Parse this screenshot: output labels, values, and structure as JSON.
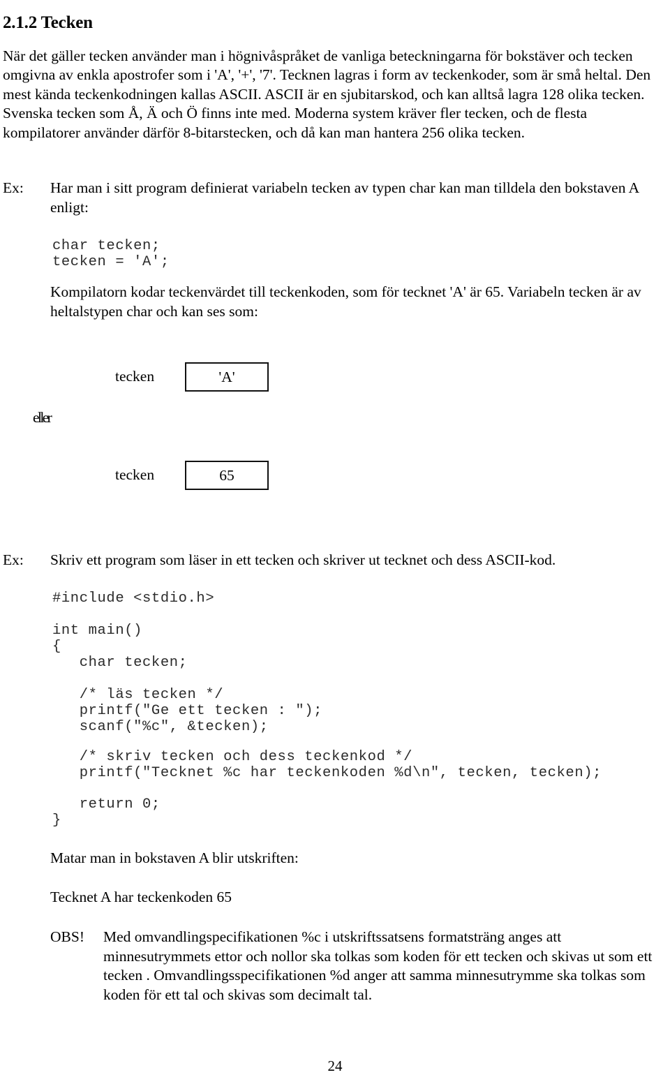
{
  "document": {
    "heading": "2.1.2 Tecken",
    "page_number": "24",
    "intro_paragraph": "När det gäller tecken använder man i högnivåspråket de vanliga beteckningarna för bokstäver och tecken omgivna av enkla apostrofer som i 'A', '+', '7'. Tecknen lagras i form av teckenkoder, som är små heltal. Den mest kända teckenkodningen kallas ASCII. ASCII är en sjubitarskod, och kan alltså lagra 128 olika tecken. Svenska tecken som Å, Ä och Ö finns inte med. Moderna system kräver fler tecken, och de flesta kompilatorer använder därför 8-bitarstecken, och då kan man hantera 256 olika tecken."
  },
  "example_one": {
    "label": "Ex:",
    "intro": "Har man i sitt program definierat variabeln tecken av typen char kan man tilldela den bokstaven A enligt:",
    "code": "char tecken;\ntecken = 'A';",
    "explanation": "Kompilatorn kodar teckenvärdet till teckenkoden, som för tecknet 'A' är 65. Variabeln tecken är av heltalstypen char och kan ses som:"
  },
  "diagram": {
    "box_one_label": "tecken",
    "box_one_value": "'A'",
    "connector_text": "eller",
    "box_two_label": "tecken",
    "box_two_value": "65"
  },
  "example_two": {
    "label": "Ex:",
    "intro": "Skriv ett program som läser in ett tecken och skriver ut tecknet och dess ASCII-kod.",
    "code_include": "#include <stdio.h>",
    "code_main": "int main()\n{\n   char tecken;",
    "code_read": "   /* läs tecken */\n   printf(\"Ge ett tecken : \");\n   scanf(\"%c\", &tecken);",
    "code_write": "   /* skriv tecken och dess teckenkod */\n   printf(\"Tecknet %c har teckenkoden %d\\n\", tecken, tecken);",
    "code_return": "   return 0;\n}",
    "output_intro": "Matar man in bokstaven A blir utskriften:",
    "output_text": "Tecknet A har teckenkoden 65"
  },
  "note": {
    "label": "OBS!",
    "text": "Med omvandlingspecifikationen %c i utskriftssatsens formatsträng anges att minnesutrymmets ettor och nollor ska tolkas som koden för ett tecken och skivas ut som ett tecken . Omvandlingsspecifikationen %d anger att samma minnesutrymme ska tolkas som koden för ett tal och skivas som decimalt tal."
  }
}
